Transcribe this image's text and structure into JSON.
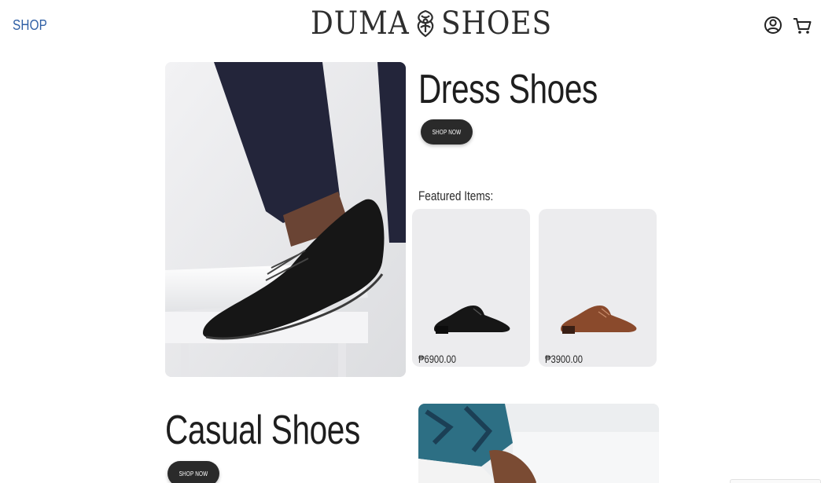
{
  "header": {
    "shop_label": "SHOP",
    "logo_left": "DUMA",
    "logo_right": "SHOES",
    "icons": [
      "account-icon",
      "cart-icon"
    ]
  },
  "dress": {
    "title": "Dress Shoes",
    "button_label": "SHOP NOW",
    "featured_label": "Featured Items:",
    "products": [
      {
        "price": "₱6900.00",
        "color": "#1a1a1a"
      },
      {
        "price": "₱3900.00",
        "color": "#8a4a2c"
      }
    ]
  },
  "casual": {
    "title": "Casual Shoes",
    "button_label": "SHOP NOW"
  },
  "colors": {
    "accent_link": "#2f5fa5",
    "button": "#2a2a2a",
    "card_bg": "#ececee"
  }
}
